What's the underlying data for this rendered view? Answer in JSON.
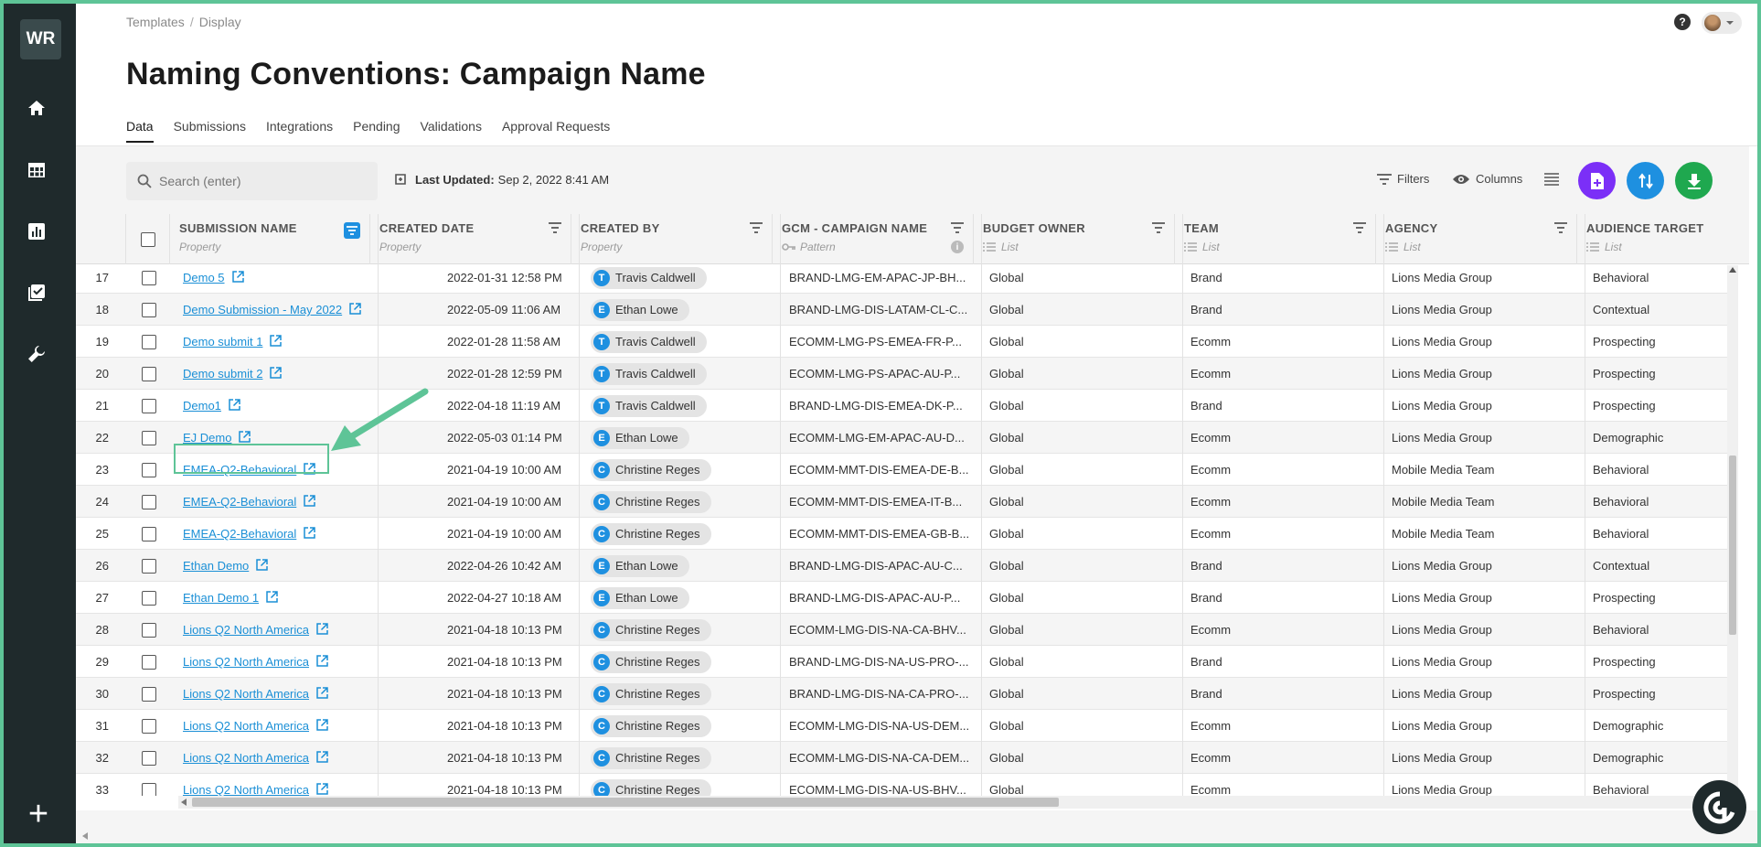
{
  "sidebar": {
    "logo": "WR",
    "items": [
      "home-icon",
      "table-icon",
      "chart-icon",
      "checklist-icon",
      "wrench-icon"
    ],
    "add_label": "+"
  },
  "breadcrumb": [
    "Templates",
    "Display"
  ],
  "breadcrumb_sep": "/",
  "page_title": "Naming Conventions: Campaign Name",
  "tabs": [
    {
      "label": "Data"
    },
    {
      "label": "Submissions"
    },
    {
      "label": "Integrations"
    },
    {
      "label": "Pending"
    },
    {
      "label": "Validations"
    },
    {
      "label": "Approval Requests"
    }
  ],
  "help_label": "?",
  "search": {
    "placeholder": "Search (enter)"
  },
  "last_updated": {
    "label": "Last Updated:",
    "value": "Sep 2, 2022 8:41 AM"
  },
  "toolbar": {
    "filters": "Filters",
    "columns": "Columns"
  },
  "colors": {
    "purple": "#7b2ff7",
    "blue": "#1e90e0",
    "green": "#1fa84f",
    "link": "#1a8fd6",
    "highlight": "#5ec497"
  },
  "columns": [
    {
      "title": "SUBMISSION NAME",
      "sub": "Property"
    },
    {
      "title": "CREATED DATE",
      "sub": "Property"
    },
    {
      "title": "CREATED BY",
      "sub": "Property"
    },
    {
      "title": "GCM - CAMPAIGN NAME",
      "sub": "Pattern"
    },
    {
      "title": "BUDGET OWNER",
      "sub": "List"
    },
    {
      "title": "TEAM",
      "sub": "List"
    },
    {
      "title": "AGENCY",
      "sub": "List"
    },
    {
      "title": "AUDIENCE TARGET",
      "sub": "List"
    }
  ],
  "rows": [
    {
      "num": "17",
      "name": "Demo 5",
      "date": "2022-01-31 12:58 PM",
      "initial": "T",
      "by": "Travis Caldwell",
      "gcm": "BRAND-LMG-EM-APAC-JP-BH...",
      "owner": "Global",
      "team": "Brand",
      "agency": "Lions Media Group",
      "target": "Behavioral"
    },
    {
      "num": "18",
      "name": "Demo Submission - May 2022",
      "date": "2022-05-09 11:06 AM",
      "initial": "E",
      "by": "Ethan Lowe",
      "gcm": "BRAND-LMG-DIS-LATAM-CL-C...",
      "owner": "Global",
      "team": "Brand",
      "agency": "Lions Media Group",
      "target": "Contextual"
    },
    {
      "num": "19",
      "name": "Demo submit 1",
      "date": "2022-01-28 11:58 AM",
      "initial": "T",
      "by": "Travis Caldwell",
      "gcm": "ECOMM-LMG-PS-EMEA-FR-P...",
      "owner": "Global",
      "team": "Ecomm",
      "agency": "Lions Media Group",
      "target": "Prospecting"
    },
    {
      "num": "20",
      "name": "Demo submit 2",
      "date": "2022-01-28 12:59 PM",
      "initial": "T",
      "by": "Travis Caldwell",
      "gcm": "ECOMM-LMG-PS-APAC-AU-P...",
      "owner": "Global",
      "team": "Ecomm",
      "agency": "Lions Media Group",
      "target": "Prospecting"
    },
    {
      "num": "21",
      "name": "Demo1",
      "date": "2022-04-18 11:19 AM",
      "initial": "T",
      "by": "Travis Caldwell",
      "gcm": "BRAND-LMG-DIS-EMEA-DK-P...",
      "owner": "Global",
      "team": "Brand",
      "agency": "Lions Media Group",
      "target": "Prospecting"
    },
    {
      "num": "22",
      "name": "EJ Demo",
      "date": "2022-05-03 01:14 PM",
      "initial": "E",
      "by": "Ethan Lowe",
      "gcm": "ECOMM-LMG-EM-APAC-AU-D...",
      "owner": "Global",
      "team": "Ecomm",
      "agency": "Lions Media Group",
      "target": "Demographic"
    },
    {
      "num": "23",
      "name": "EMEA-Q2-Behavioral",
      "date": "2021-04-19 10:00 AM",
      "initial": "C",
      "by": "Christine Reges",
      "gcm": "ECOMM-MMT-DIS-EMEA-DE-B...",
      "owner": "Global",
      "team": "Ecomm",
      "agency": "Mobile Media Team",
      "target": "Behavioral"
    },
    {
      "num": "24",
      "name": "EMEA-Q2-Behavioral",
      "date": "2021-04-19 10:00 AM",
      "initial": "C",
      "by": "Christine Reges",
      "gcm": "ECOMM-MMT-DIS-EMEA-IT-B...",
      "owner": "Global",
      "team": "Ecomm",
      "agency": "Mobile Media Team",
      "target": "Behavioral"
    },
    {
      "num": "25",
      "name": "EMEA-Q2-Behavioral",
      "date": "2021-04-19 10:00 AM",
      "initial": "C",
      "by": "Christine Reges",
      "gcm": "ECOMM-MMT-DIS-EMEA-GB-B...",
      "owner": "Global",
      "team": "Ecomm",
      "agency": "Mobile Media Team",
      "target": "Behavioral"
    },
    {
      "num": "26",
      "name": "Ethan Demo",
      "date": "2022-04-26 10:42 AM",
      "initial": "E",
      "by": "Ethan Lowe",
      "gcm": "BRAND-LMG-DIS-APAC-AU-C...",
      "owner": "Global",
      "team": "Brand",
      "agency": "Lions Media Group",
      "target": "Contextual"
    },
    {
      "num": "27",
      "name": "Ethan Demo 1",
      "date": "2022-04-27 10:18 AM",
      "initial": "E",
      "by": "Ethan Lowe",
      "gcm": "BRAND-LMG-DIS-APAC-AU-P...",
      "owner": "Global",
      "team": "Brand",
      "agency": "Lions Media Group",
      "target": "Prospecting"
    },
    {
      "num": "28",
      "name": "Lions Q2 North America",
      "date": "2021-04-18 10:13 PM",
      "initial": "C",
      "by": "Christine Reges",
      "gcm": "ECOMM-LMG-DIS-NA-CA-BHV...",
      "owner": "Global",
      "team": "Ecomm",
      "agency": "Lions Media Group",
      "target": "Behavioral"
    },
    {
      "num": "29",
      "name": "Lions Q2 North America",
      "date": "2021-04-18 10:13 PM",
      "initial": "C",
      "by": "Christine Reges",
      "gcm": "BRAND-LMG-DIS-NA-US-PRO-...",
      "owner": "Global",
      "team": "Brand",
      "agency": "Lions Media Group",
      "target": "Prospecting"
    },
    {
      "num": "30",
      "name": "Lions Q2 North America",
      "date": "2021-04-18 10:13 PM",
      "initial": "C",
      "by": "Christine Reges",
      "gcm": "BRAND-LMG-DIS-NA-CA-PRO-...",
      "owner": "Global",
      "team": "Brand",
      "agency": "Lions Media Group",
      "target": "Prospecting"
    },
    {
      "num": "31",
      "name": "Lions Q2 North America",
      "date": "2021-04-18 10:13 PM",
      "initial": "C",
      "by": "Christine Reges",
      "gcm": "ECOMM-LMG-DIS-NA-US-DEM...",
      "owner": "Global",
      "team": "Ecomm",
      "agency": "Lions Media Group",
      "target": "Demographic"
    },
    {
      "num": "32",
      "name": "Lions Q2 North America",
      "date": "2021-04-18 10:13 PM",
      "initial": "C",
      "by": "Christine Reges",
      "gcm": "ECOMM-LMG-DIS-NA-CA-DEM...",
      "owner": "Global",
      "team": "Ecomm",
      "agency": "Lions Media Group",
      "target": "Demographic"
    },
    {
      "num": "33",
      "name": "Lions Q2 North America",
      "date": "2021-04-18 10:13 PM",
      "initial": "C",
      "by": "Christine Reges",
      "gcm": "ECOMM-LMG-DIS-NA-US-BHV...",
      "owner": "Global",
      "team": "Ecomm",
      "agency": "Lions Media Group",
      "target": "Behavioral"
    }
  ]
}
